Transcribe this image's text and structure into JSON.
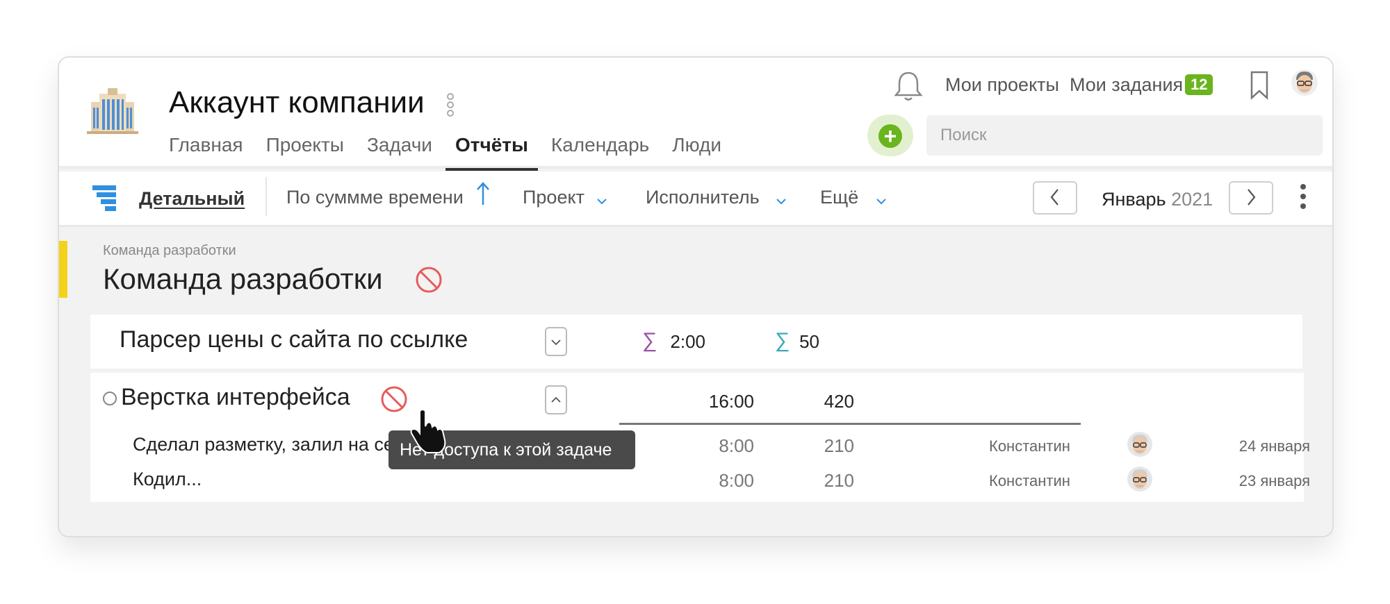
{
  "header": {
    "company_name": "Аккаунт компании",
    "nav": [
      "Главная",
      "Проекты",
      "Задачи",
      "Отчёты",
      "Календарь",
      "Люди"
    ],
    "active_nav": "Отчёты",
    "my_projects": "Мои проекты",
    "my_tasks": "Мои задания",
    "my_tasks_count": "12",
    "search_placeholder": "Поиск",
    "add_button": "+"
  },
  "toolbar": {
    "view": "Детальный",
    "sort": "По суммме времени",
    "filters": [
      "Проект",
      "Исполнитель",
      "Ещё"
    ],
    "month": "Январь",
    "year": "2021"
  },
  "group": {
    "breadcrumb": "Команда разработки",
    "title": "Команда разработки"
  },
  "tasks": [
    {
      "title": "Парсер цены с сайта по ссылке",
      "time_total": "2:00",
      "points_total": "50"
    },
    {
      "title": "Верстка интерфейса",
      "time_total": "16:00",
      "points_total": "420",
      "entries": [
        {
          "text": "Сделал разметку, залил на сервак",
          "time": "8:00",
          "points": "210",
          "person": "Константин",
          "date": "24 января"
        },
        {
          "text": "Кодил...",
          "time": "8:00",
          "points": "210",
          "person": "Константин",
          "date": "23 января"
        }
      ]
    }
  ],
  "tooltip": "Нет доступа к этой задаче",
  "colors": {
    "accent_green": "#6ab41e",
    "accent_blue": "#2f8fe0",
    "warning_red": "#e85a5a",
    "group_marker": "#f5d21a",
    "sum_time": "#9b4fa8",
    "sum_points": "#3aa8b8"
  },
  "icons": {
    "bell": "bell-icon",
    "bookmark": "bookmark-icon",
    "no_access": "no-access-icon",
    "cursor": "hand-pointer-icon"
  }
}
